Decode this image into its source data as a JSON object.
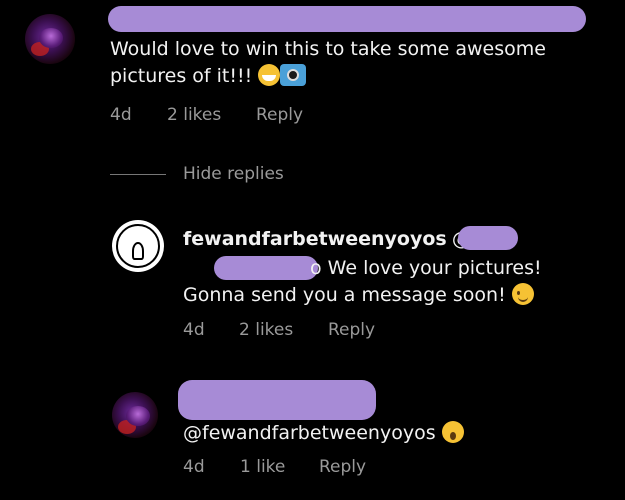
{
  "comments": [
    {
      "text": "Would love to win this to take some awesome pictures of it!!!",
      "emoji_1": "grinning-face-icon",
      "emoji_2": "camera-with-flash-icon",
      "time": "4d",
      "likes": "2 likes",
      "reply_label": "Reply"
    }
  ],
  "replies_toggle": "Hide replies",
  "replies": [
    {
      "username": "fewandfarbetweenyoyos",
      "mention_prefix": "@",
      "text_line1": "o We love your pictures!",
      "text_line2": "Gonna send you a message soon!",
      "emoji": "winking-face-icon",
      "time": "4d",
      "likes": "2 likes",
      "reply_label": "Reply"
    },
    {
      "text": "@fewandfarbetweenyoyos",
      "emoji": "hushed-face-icon",
      "time": "4d",
      "likes": "1 like",
      "reply_label": "Reply"
    }
  ],
  "colors": {
    "background": "#000000",
    "text": "#f2f2f2",
    "meta": "#9a9a9a",
    "redaction": "#a78bd6"
  }
}
